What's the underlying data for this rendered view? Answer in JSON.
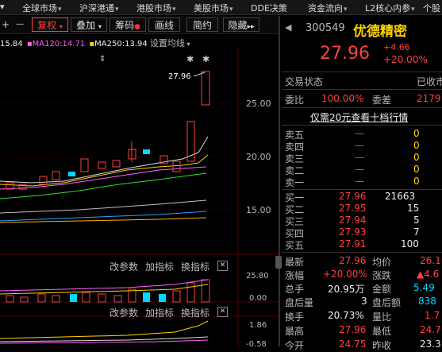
{
  "top_menu": {
    "items": [
      {
        "label": "全球市场",
        "caret": "▾"
      },
      {
        "label": "沪深港通",
        "caret": "▾"
      },
      {
        "label": "港股市场",
        "caret": "▾"
      },
      {
        "label": "美股市场",
        "caret": "▾"
      },
      {
        "label": "DDE决策",
        "caret": ""
      },
      {
        "label": "资金流向",
        "caret": "▾"
      },
      {
        "label": "L2核心内参",
        "caret": "▾"
      },
      {
        "label": "个股",
        "caret": ""
      }
    ]
  },
  "toolbar": {
    "plus": "+",
    "minus": "—",
    "restore_rights": "复权",
    "overlay": "叠加",
    "chips": "筹码",
    "draw_line": "画线",
    "simple_agreement": "简约",
    "hide": "隐藏",
    "more": "▸▸"
  },
  "ma_legend": {
    "ma60": "15.84",
    "ma120_label": "MA120:14.71",
    "ma250_label": "MA250:13.94",
    "settings": "设置均线"
  },
  "price_axis": {
    "ticks": [
      "25.00",
      "20.00",
      "15.00"
    ],
    "peak_label": "27.96",
    "ind1_ticks": [
      "25.80",
      "0.00"
    ],
    "ind2_ticks": [
      "1.86",
      "-0.58"
    ]
  },
  "indicator_panels": [
    {
      "change_params": "改参数",
      "add_indicator": "加指标",
      "switch_indicator": "换指标"
    },
    {
      "change_params": "改参数",
      "add_indicator": "加指标",
      "switch_indicator": "换指标"
    }
  ],
  "stock": {
    "code": "300549",
    "name": "优德精密",
    "price": "27.96",
    "change": "+4.66",
    "change_pct": "+20.00%"
  },
  "trade_status": {
    "label": "交易状态",
    "value": "已收市"
  },
  "order_ratio": {
    "wb_label": "委比",
    "wb_value": "100.00%",
    "wc_label": "委差",
    "wc_value": "2179"
  },
  "ten_levels_link": "仅需20元查看十档行情",
  "asks": [
    {
      "label": "卖五",
      "price": "—",
      "vol": "0"
    },
    {
      "label": "卖四",
      "price": "—",
      "vol": "0"
    },
    {
      "label": "卖三",
      "price": "—",
      "vol": "0"
    },
    {
      "label": "卖二",
      "price": "—",
      "vol": "0"
    },
    {
      "label": "卖一",
      "price": "—",
      "vol": "0"
    }
  ],
  "bids": [
    {
      "label": "买一",
      "price": "27.96",
      "vol": "21663"
    },
    {
      "label": "买二",
      "price": "27.95",
      "vol": "15"
    },
    {
      "label": "买三",
      "price": "27.94",
      "vol": "5"
    },
    {
      "label": "买四",
      "price": "27.93",
      "vol": "7"
    },
    {
      "label": "买五",
      "price": "27.91",
      "vol": "100"
    }
  ],
  "stats": {
    "latest_label": "最新",
    "latest": "27.96",
    "avg_label": "均价",
    "avg": "26.1",
    "pct_label": "涨幅",
    "pct": "+20.00%",
    "chg_label": "涨跌",
    "chg": "▲4.6",
    "vol_label": "总手",
    "vol": "20.95万",
    "amount_label": "金额",
    "amount": "5.49",
    "afterhours_label": "盘后量",
    "afterhours": "3",
    "afterhours_amt_label": "盘后额",
    "afterhours_amt": "838",
    "turnover_label": "换手",
    "turnover": "20.73%",
    "vol_ratio_label": "量比",
    "vol_ratio": "1.7",
    "high_label": "最高",
    "high": "27.96",
    "low_label": "最低",
    "low": "24.7",
    "open_label": "今开",
    "open": "24.75",
    "prev_label": "昨收",
    "prev": "23.3"
  }
}
